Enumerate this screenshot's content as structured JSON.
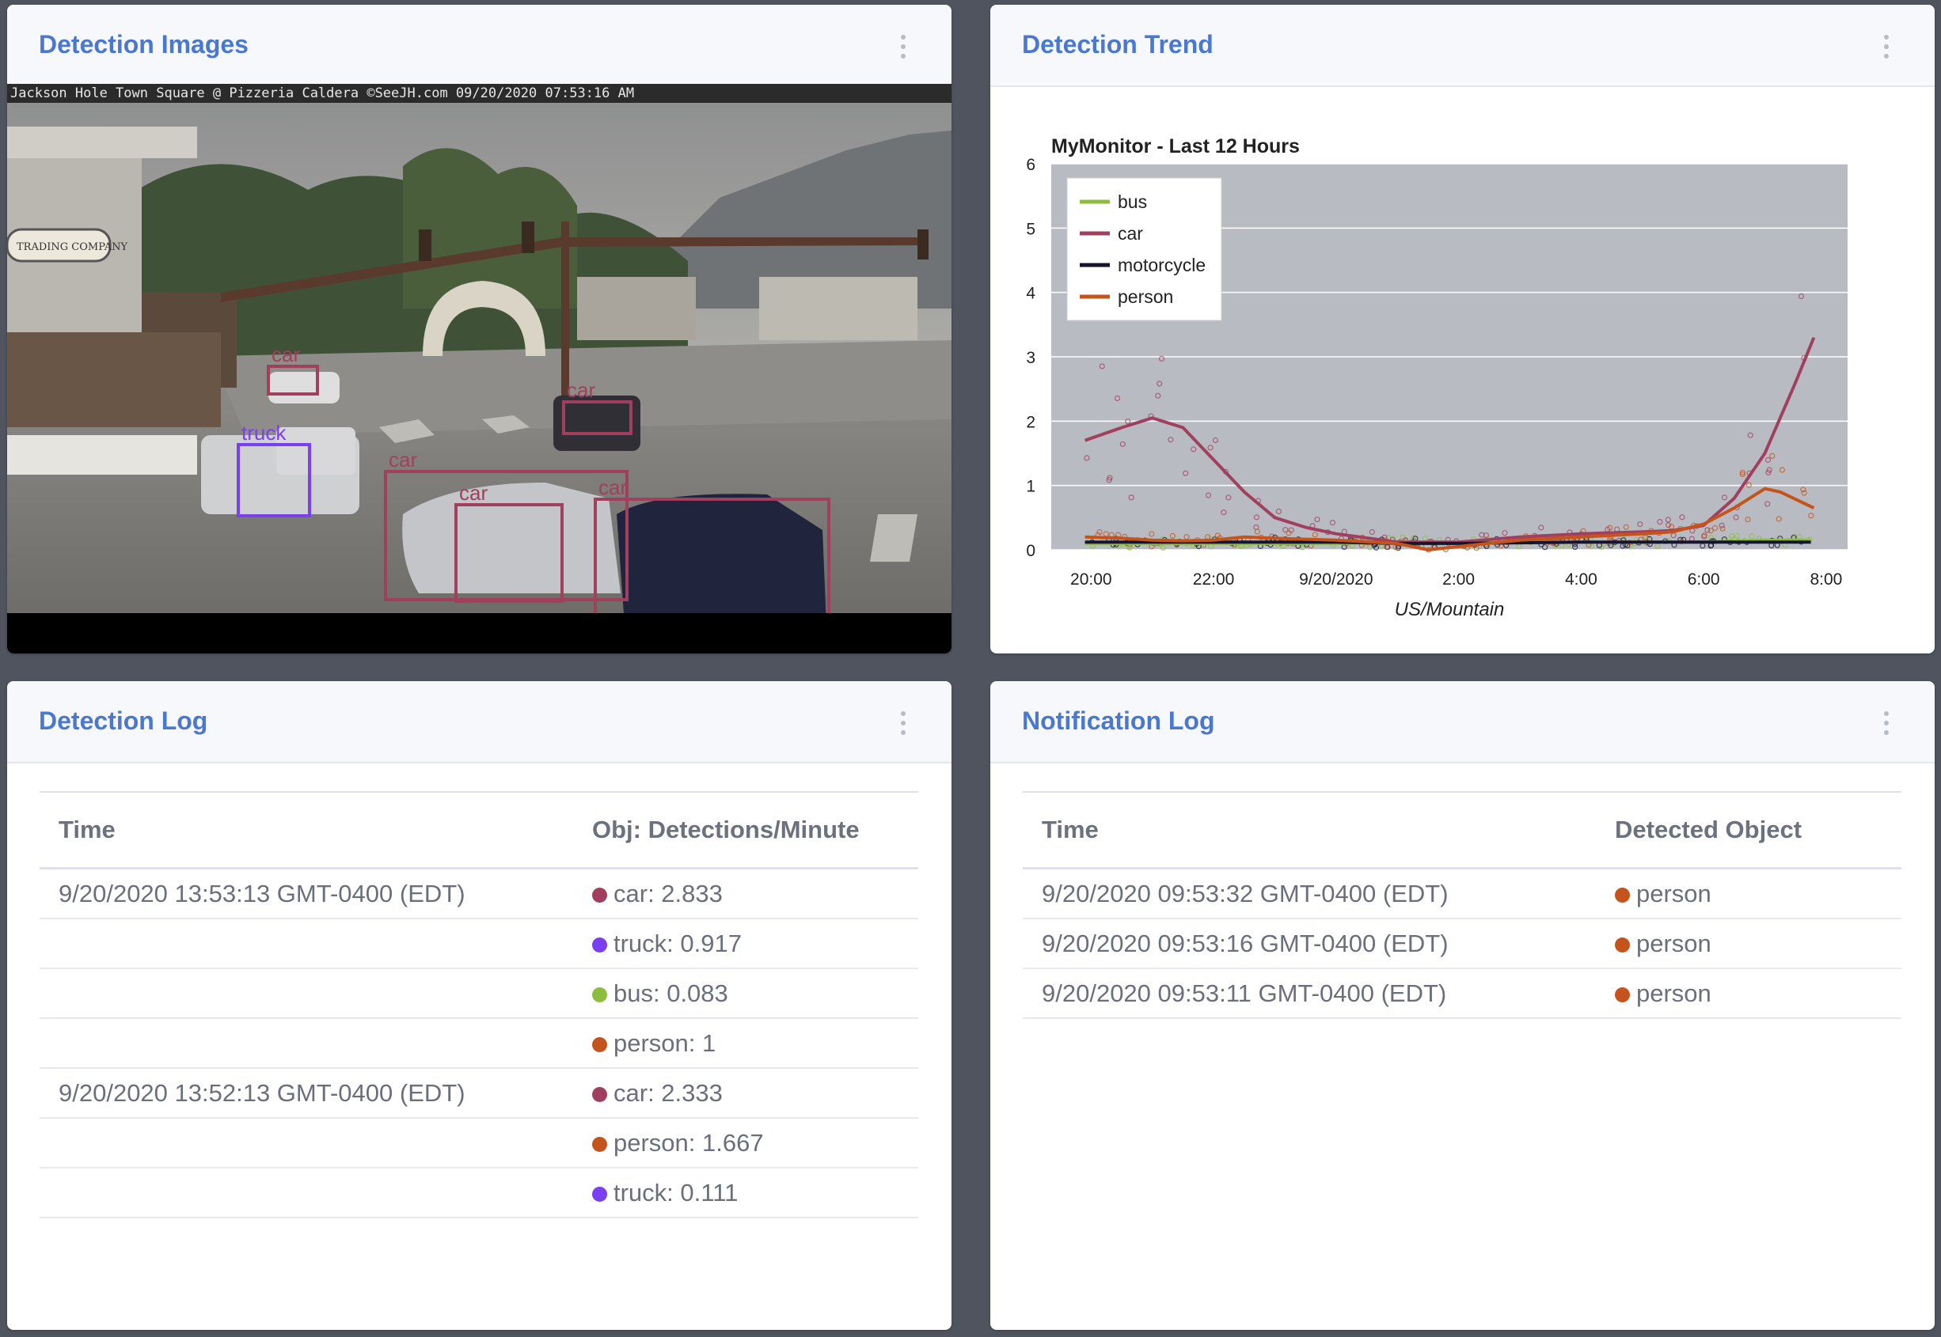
{
  "colors": {
    "accent": "#4a78d0",
    "car": "#a0405e",
    "truck": "#7a3ff0",
    "bus": "#8dbd3e",
    "person": "#c4541c",
    "motorcycle": "#15152e"
  },
  "cards": {
    "images": {
      "title": "Detection Images",
      "menu_icon": "kebab-vertical-icon"
    },
    "trend": {
      "title": "Detection Trend",
      "menu_icon": "kebab-vertical-icon"
    },
    "detection_log": {
      "title": "Detection Log",
      "menu_icon": "kebab-vertical-icon"
    },
    "notification_log": {
      "title": "Notification Log",
      "menu_icon": "kebab-vertical-icon"
    }
  },
  "camera": {
    "caption": "Jackson Hole Town Square @ Pizzeria Caldera ©SeeJH.com 09/20/2020 07:53:16 AM",
    "sign_text": "TRADING COMPANY",
    "boxes": [
      {
        "label": "car",
        "class": "car"
      },
      {
        "label": "car",
        "class": "car"
      },
      {
        "label": "truck",
        "class": "truck"
      },
      {
        "label": "car",
        "class": "car"
      },
      {
        "label": "car",
        "class": "car"
      },
      {
        "label": "car",
        "class": "car"
      }
    ]
  },
  "chart_data": {
    "type": "line",
    "title": "MyMonitor - Last 12 Hours",
    "xlabel": "US/Mountain",
    "ylabel": "",
    "x_ticks": [
      "20:00",
      "22:00",
      "9/20/2020",
      "2:00",
      "4:00",
      "6:00",
      "8:00"
    ],
    "x_tick_hours": [
      0,
      4,
      8,
      12,
      16,
      20,
      24
    ],
    "ylim": [
      0,
      6
    ],
    "y_ticks": [
      0,
      1,
      2,
      3,
      4,
      5,
      6
    ],
    "grid": true,
    "legend_position": "top-left",
    "series": [
      {
        "name": "bus",
        "color": "#8dbd3e",
        "points": [
          [
            -0.2,
            0.1
          ],
          [
            2,
            0.1
          ],
          [
            4,
            0.1
          ],
          [
            6,
            0.1
          ],
          [
            8,
            0.1
          ],
          [
            10,
            0.12
          ],
          [
            12,
            0.12
          ],
          [
            16,
            0.12
          ],
          [
            20,
            0.12
          ],
          [
            22,
            0.15
          ],
          [
            23.5,
            0.15
          ]
        ]
      },
      {
        "name": "car",
        "color": "#a0405e",
        "points": [
          [
            -0.2,
            1.7
          ],
          [
            1,
            1.9
          ],
          [
            2,
            2.05
          ],
          [
            3,
            1.9
          ],
          [
            4,
            1.4
          ],
          [
            5,
            0.9
          ],
          [
            6,
            0.5
          ],
          [
            7,
            0.35
          ],
          [
            8,
            0.25
          ],
          [
            10,
            0.12
          ],
          [
            12,
            0.12
          ],
          [
            14,
            0.2
          ],
          [
            16,
            0.25
          ],
          [
            18,
            0.28
          ],
          [
            19,
            0.3
          ],
          [
            20,
            0.38
          ],
          [
            21,
            0.8
          ],
          [
            22,
            1.5
          ],
          [
            23,
            2.6
          ],
          [
            23.6,
            3.3
          ]
        ]
      },
      {
        "name": "motorcycle",
        "color": "#15152e",
        "points": [
          [
            -0.2,
            0.12
          ],
          [
            2,
            0.12
          ],
          [
            4,
            0.12
          ],
          [
            6,
            0.12
          ],
          [
            8,
            0.12
          ],
          [
            10,
            0.1
          ],
          [
            12,
            0.1
          ],
          [
            16,
            0.12
          ],
          [
            20,
            0.12
          ],
          [
            23.5,
            0.12
          ]
        ]
      },
      {
        "name": "person",
        "color": "#c4541c",
        "points": [
          [
            -0.2,
            0.2
          ],
          [
            1,
            0.18
          ],
          [
            2,
            0.15
          ],
          [
            3,
            0.14
          ],
          [
            4,
            0.15
          ],
          [
            5,
            0.2
          ],
          [
            6,
            0.18
          ],
          [
            8,
            0.15
          ],
          [
            10,
            0.1
          ],
          [
            11,
            0.0
          ],
          [
            12,
            0.05
          ],
          [
            14,
            0.15
          ],
          [
            16,
            0.2
          ],
          [
            18,
            0.25
          ],
          [
            19,
            0.28
          ],
          [
            20,
            0.4
          ],
          [
            21,
            0.65
          ],
          [
            22,
            0.95
          ],
          [
            22.5,
            0.9
          ],
          [
            23.6,
            0.65
          ]
        ]
      }
    ]
  },
  "detection_log": {
    "headers": [
      "Time",
      "Obj: Detections/Minute"
    ],
    "rows": [
      {
        "time": "9/20/2020 13:53:13 GMT-0400 (EDT)",
        "object": "car",
        "value": "car: 2.833"
      },
      {
        "time": "",
        "object": "truck",
        "value": "truck: 0.917"
      },
      {
        "time": "",
        "object": "bus",
        "value": "bus: 0.083"
      },
      {
        "time": "",
        "object": "person",
        "value": "person: 1"
      },
      {
        "time": "9/20/2020 13:52:13 GMT-0400 (EDT)",
        "object": "car",
        "value": "car: 2.333"
      },
      {
        "time": "",
        "object": "person",
        "value": "person: 1.667"
      },
      {
        "time": "",
        "object": "truck",
        "value": "truck: 0.111"
      }
    ]
  },
  "notification_log": {
    "headers": [
      "Time",
      "Detected Object"
    ],
    "rows": [
      {
        "time": "9/20/2020 09:53:32 GMT-0400 (EDT)",
        "object": "person",
        "value": "person"
      },
      {
        "time": "9/20/2020 09:53:16 GMT-0400 (EDT)",
        "object": "person",
        "value": "person"
      },
      {
        "time": "9/20/2020 09:53:11 GMT-0400 (EDT)",
        "object": "person",
        "value": "person"
      }
    ]
  }
}
